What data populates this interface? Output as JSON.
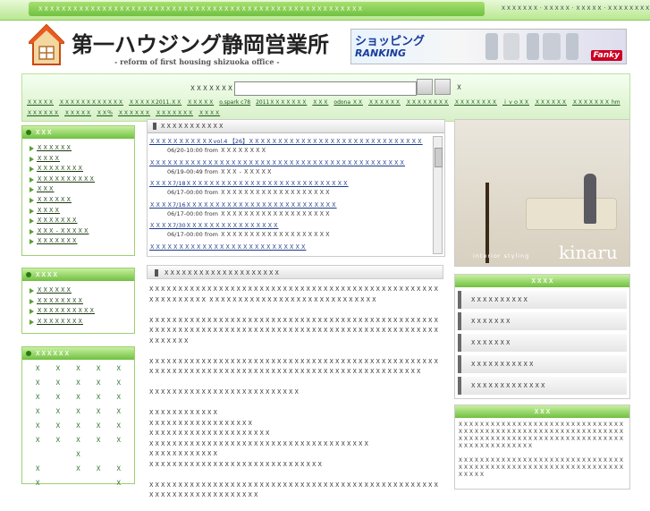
{
  "topbar": {
    "intro": "ＸＸＸＸＸＸＸＸＸＸＸＸＸＸＸＸＸＸＸＸＸＸＸＸＸＸＸＸＸＸＸＸＸＸＸＸＸＸＸＸＸＸＸＸＸＸＸＸＸＸＸＸＸＸＸＸ",
    "links": "ＸＸＸＸＸＸＸ · ＸＸＸＸＸ · ＸＸＸＸＸ · ＸＸＸＸＸＸＸＸ"
  },
  "header": {
    "title": "第一ハウジング静岡営業所",
    "subtitle": "- reform of first housing shizuoka office -",
    "banner_line1": "ショッピング",
    "banner_line2": "RANKING",
    "banner_brand": "Fanky"
  },
  "search": {
    "label": "ＸＸＸＸＸＸＸＸ",
    "placeholder": "",
    "trailing": "Ｘ",
    "tags": [
      "ＸＸＸＸＸ",
      "ＸＸＸＸＸＸＸＸＸＸＸＸ",
      "ＸＸＸＸＸ2011.ＸＸ",
      "ＸＸＸＸＸ",
      "o.spark c78",
      "2011ＸＸＸＸＸＸＸ",
      "ＸＸＸ",
      "odona ＸＸ",
      "ＸＸＸＸＸＸ",
      "ＸＸＸＸＸＸＸＸ",
      "ＸＸＸＸＸＸＸＸ",
      "ｉｖｏＸＸ",
      "ＸＸＸＸＸＸ",
      "ＸＸＸＸＸＸＸ hm",
      "ＸＸＸＸＸＸ",
      "ＸＸＸＸＸ",
      "ＸＸ％",
      "ＸＸＸＸＸＸ",
      "ＸＸＸＸＸＸＸ",
      "ＸＸＸＸ"
    ]
  },
  "left_nav": {
    "title": "ＸＸＸ",
    "items": [
      "ＸＸＸＸＸＸ",
      "ＸＸＸＸ",
      "ＸＸＸＸＸＸＸＸ",
      "ＸＸＸＸＸＸＸＸＸＸ",
      "ＸＸＸ",
      "ＸＸＸＸＸＸ",
      "ＸＸＸＸ",
      "ＸＸＸＸＸＸＸ",
      "ＸＸＸ - ＸＸＸＸＸ",
      "ＸＸＸＸＸＸＸ"
    ]
  },
  "left_nav2": {
    "title": "ＸＸＸＸ",
    "items": [
      "ＸＸＸＸＸＸ",
      "ＸＸＸＸＸＸＸＸ",
      "ＸＸＸＸＸＸＸＸＸＸ",
      "ＸＸＸＸＸＸＸＸ"
    ]
  },
  "left_grid": {
    "title": "ＸＸＸＸＸＸ",
    "cells": [
      "Ｘ",
      "Ｘ",
      "Ｘ",
      "Ｘ",
      "Ｘ",
      "Ｘ",
      "Ｘ",
      "Ｘ",
      "Ｘ",
      "Ｘ",
      "Ｘ",
      "Ｘ",
      "Ｘ",
      "Ｘ",
      "Ｘ",
      "Ｘ",
      "Ｘ",
      "Ｘ",
      "Ｘ",
      "Ｘ",
      "Ｘ",
      "Ｘ",
      "Ｘ",
      "Ｘ",
      "Ｘ",
      "Ｘ",
      "Ｘ",
      "Ｘ",
      "Ｘ",
      "Ｘ",
      "",
      "",
      "Ｘ",
      "",
      "",
      "Ｘ",
      "",
      "Ｘ",
      "Ｘ",
      "Ｘ",
      "Ｘ",
      "",
      "",
      "",
      "Ｘ"
    ]
  },
  "news": {
    "title": "ＸＸＸＸＸＸＸＸＸＸＸ",
    "items": [
      {
        "title": "ＸＸＸＸＸＸＸＸＸＸＸvol.4 【26】ＸＸＸＸＸＸＸＸＸＸＸＸＸＸＸＸＸＸＸＸＸＸＸＸＸＸＸＸＸＸ",
        "meta": "06/20-10:00 from ＸＸＸＸＸＸＸＸ"
      },
      {
        "title": "ＸＸＸＸＸＸＸＸＸＸＸＸＸＸＸＸＸＸＸＸＸＸＸＸＸＸＸＸＸＸＸＸＸＸＸＸＸＸＸＸＸＸＸＸ",
        "meta": "06/19-00:49 from ＸＸＸ - ＸＸＸＸＸ"
      },
      {
        "title": "ＸＸＸＸ7/18ＸＸＸＸＸＸＸＸＸＸＸＸＸＸＸＸＸＸＸＸＸＸＸＸＸＸＸＸ",
        "meta": "06/17-00:00 from ＸＸＸＸＸＸＸＸＸＸＸＸＸＸＸＸＸＸＸ"
      },
      {
        "title": "ＸＸＸＸ7/16ＸＸＸＸＸＸＸＸＸＸＸＸＸＸＸＸＸＸＸＸＸＸＸＸＸＸ",
        "meta": "06/17-00:00 from ＸＸＸＸＸＸＸＸＸＸＸＸＸＸＸＸＸＸＸ"
      },
      {
        "title": "ＸＸＸＸ7/30ＸＸＸＸＸＸＸＸＸＸＸＸＸＸＸＸ",
        "meta": "06/17-00:00 from ＸＸＸＸＸＸＸＸＸＸＸＸＸＸＸＸＸＸＸ"
      },
      {
        "title": "ＸＸＸＸＸＸＸＸＸＸＸＸＸＸＸＸＸＸＸＸＸＸＸＸＸＸＸ",
        "meta": ""
      }
    ]
  },
  "article": {
    "title": "ＸＸＸＸＸＸＸＸＸＸＸＸＸＸＸＸＸＸＸＸ",
    "paragraphs": [
      "ＸＸＸＸＸＸＸＸＸＸＸＸＸＸＸＸＸＸＸＸＸＸＸＸＸＸＸＸＸＸＸＸＸＸＸＸＸＸＸＸＸＸＸＸＸＸＸＸＸＸＸＸＸＸＸＸＸＸＸＸ ＸＸＸＸＸＸＸＸＸＸＸＸＸＸＸＸＸＸＸＸＸＸＸＸＸＸＸＸＸ",
      "ＸＸＸＸＸＸＸＸＸＸＸＸＸＸＸＸＸＸＸＸＸＸＸＸＸＸＸＸＸＸＸＸＸＸＸＸＸＸＸＸＸＸＸＸＸＸＸＸＸＸＸＸＸＸＸＸＸＸＸＸＸＸＸＸＸＸＸＸＸＸＸＸＸＸＸＸＸＸＸＸＸＸＸＸＸＸＸＸＸＸＸＸＸＸＸＸＸＸＸＸＸＸＸＸＸＸＸ",
      "ＸＸＸＸＸＸＸＸＸＸＸＸＸＸＸＸＸＸＸＸＸＸＸＸＸＸＸＸＸＸＸＸＸＸＸＸＸＸＸＸＸＸＸＸＸＸＸＸＸＸＸＸＸＸＸＸＸＸＸＸＸＸＸＸＸＸＸＸＸＸＸＸＸＸＸＸＸＸＸＸＸＸＸＸＸＸＸＸＸＸＸＸＸＸＸＸＸ",
      "ＸＸＸＸＸＸＸＸＸＸＸＸＸＸＸＸＸＸＸＸＸＸＸＸＸＸ",
      "ＸＸＸＸＸＸＸＸＸＸＸＸ\nＸＸＸＸＸＸＸＸＸＸＸＸＸＸＸＸＸＸ\nＸＸＸＸＸＸＸＸＸＸＸＸＸＸＸＸＸＸＸＸＸ\nＸＸＸＸＸＸＸＸＸＸＸＸＸＸＸＸＸＸＸＸＸＸＸＸＸＸＸＸＸＸＸＸＸＸＸＸＸＸ\nＸＸＸＸＸＸＸＸＸＸＸＸ\nＸＸＸＸＸＸＸＸＸＸＸＸＸＸＸＸＸＸＸＸＸＸＸＸＸＸＸＸＸＸ",
      "ＸＸＸＸＸＸＸＸＸＸＸＸＸＸＸＸＸＸＸＸＸＸＸＸＸＸＸＸＸＸＸＸＸＸＸＸＸＸＸＸＸＸＸＸＸＸＸＸＸＸＸＸＸＸＸＸＸＸＸＸＸＸＸＸＸＸＸＸＸ"
    ]
  },
  "photo": {
    "caption": "interior styling",
    "brand": "kinaru"
  },
  "right_nav": {
    "title": "ＸＸＸＸ",
    "items": [
      "ＸＸＸＸＸＸＸＸＸＸ",
      "ＸＸＸＸＸＸＸ",
      "ＸＸＸＸＸＸＸ",
      "ＸＸＸＸＸＸＸＸＸＸＸ",
      "ＸＸＸＸＸＸＸＸＸＸＸＸＸ"
    ]
  },
  "right_box": {
    "title": "ＸＸＸ",
    "paragraphs": [
      "ＸＸＸＸＸＸＸＸＸＸＸＸＸＸＸＸＸＸＸＸＸＸＸＸＸＸＸＸＸＸＸＸＸＸＸＸＸＸＸＸＸＸＸＸＸＸＸＸＸＸＸＸＸＸＸＸＸＸＸＸＸＸＸＸＸＸＸＸＸＸＸＸＸＸＸＸＸＸＸＸＸＸＸＸＸＸＸＸＸＸＸＸＸＸＸＸＸＸＸＸＸＸＸＸＸＸＸ",
      "ＸＸＸＸＸＸＸＸＸＸＸＸＸＸＸＸＸＸＸＸＸＸＸＸＸＸＸＸＸＸＸＸＸＸＸＸＸＸＸＸＸＸＸＸＸＸＸＸＸＸＸＸＸＸＸＸＸＸＸＸＸＸＸＸＸＸＸ"
    ]
  }
}
